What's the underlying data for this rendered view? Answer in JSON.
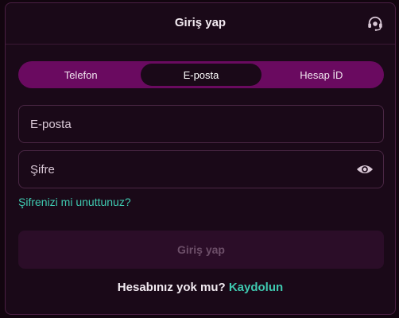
{
  "header": {
    "title": "Giriş yap",
    "support_icon": "headset-icon"
  },
  "tabs": [
    {
      "label": "Telefon",
      "active": false
    },
    {
      "label": "E-posta",
      "active": true
    },
    {
      "label": "Hesap İD",
      "active": false
    }
  ],
  "form": {
    "email_placeholder": "E-posta",
    "email_value": "",
    "password_placeholder": "Şifre",
    "password_value": "",
    "password_toggle_icon": "eye-icon",
    "forgot_label": "Şifrenizi mi unuttunuz?",
    "submit_label": "Giriş yap"
  },
  "signup": {
    "prompt": "Hesabınız yok mu?",
    "link": "Kaydolun"
  },
  "colors": {
    "page_bg": "#12050f",
    "modal_bg": "#1a0918",
    "tab_bar": "#6a0a60",
    "accent_link": "#3fc9b0",
    "disabled_button": "#2b0d28"
  }
}
